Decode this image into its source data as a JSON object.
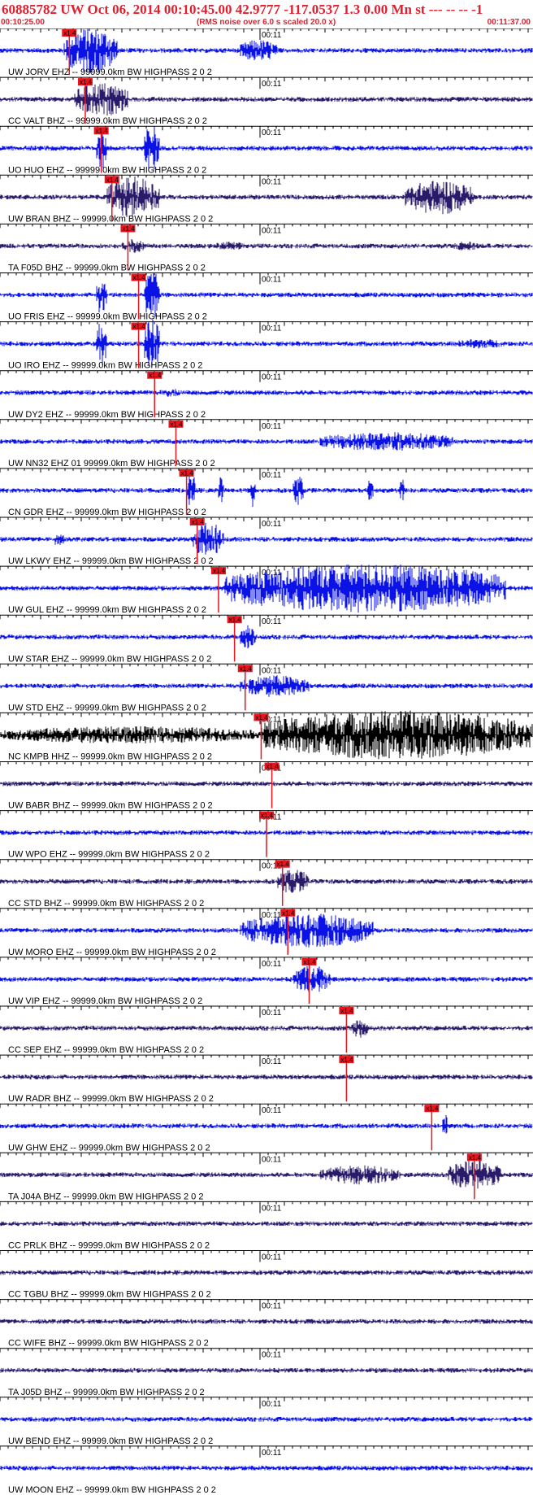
{
  "header": {
    "title": "60885782 UW Oct 06, 2014 00:10:45.00   42.9777 -117.0537  1.3 0.00 Mn st --- -- --   -1",
    "start_time": "00:10:25.00",
    "noise_note": "(RMS noise over 6.0 s scaled 20.0 x)",
    "end_time": "00:11:37.00"
  },
  "time_tick_label": "00:11",
  "pick_label": "x1.4",
  "colors": {
    "header_text": "#e0202e",
    "pick": "#e8141e",
    "trace_blue": "#0a12e6",
    "trace_dark": "#2a1a6a",
    "trace_black": "#000000"
  },
  "traces": [
    {
      "label": "UW JORV EHZ -- 99999.0km BW  HIGHPASS  2  0  2",
      "color": "blue",
      "pick": 0.13,
      "seg": [
        [
          0.12,
          0.22,
          0.95
        ],
        [
          0.45,
          0.52,
          0.45
        ]
      ]
    },
    {
      "label": "CC VALT BHZ -- 99999.0km BW  HIGHPASS  2  0  2",
      "color": "dark",
      "pick": 0.16,
      "seg": [
        [
          0.14,
          0.24,
          0.7
        ]
      ]
    },
    {
      "label": "UO HUO EHZ -- 99999.0km BW  HIGHPASS  2  0  2",
      "color": "blue",
      "pick": 0.19,
      "seg": [
        [
          0.18,
          0.2,
          0.9
        ],
        [
          0.27,
          0.3,
          1.0
        ]
      ]
    },
    {
      "label": "UW BRAN BHZ -- 99999.0km BW  HIGHPASS  2  0  2",
      "color": "dark",
      "pick": 0.21,
      "seg": [
        [
          0.2,
          0.3,
          0.85
        ],
        [
          0.76,
          0.89,
          0.7
        ]
      ]
    },
    {
      "label": "TA F05D BHZ -- 99999.0km BW  HIGHPASS  2  0  2",
      "color": "dark",
      "pick": 0.24,
      "seg": [
        [
          0.23,
          0.27,
          0.3
        ],
        [
          0.4,
          0.46,
          0.18
        ],
        [
          0.85,
          0.9,
          0.2
        ]
      ]
    },
    {
      "label": "UO FRIS EHZ -- 99999.0km BW  HIGHPASS  2  0  2",
      "color": "blue",
      "pick": 0.26,
      "seg": [
        [
          0.18,
          0.2,
          0.8
        ],
        [
          0.27,
          0.3,
          1.0
        ]
      ]
    },
    {
      "label": "UO IRO EHZ -- 99999.0km BW  HIGHPASS  2  0  2",
      "color": "blue",
      "pick": 0.26,
      "seg": [
        [
          0.18,
          0.2,
          0.9
        ],
        [
          0.27,
          0.3,
          1.0
        ],
        [
          0.85,
          0.95,
          0.2
        ]
      ]
    },
    {
      "label": "UW DY2 EHZ -- 99999.0km BW  HIGHPASS  2  0  2",
      "color": "blue",
      "pick": 0.29,
      "seg": [
        [
          0.3,
          0.34,
          0.18
        ]
      ]
    },
    {
      "label": "UW NN32 EHZ 01 99999.0km BW  HIGHPASS  2  0  2",
      "color": "blue",
      "pick": 0.33,
      "seg": [
        [
          0.6,
          0.85,
          0.4
        ]
      ]
    },
    {
      "label": "CN GDR EHZ -- 99999.0km BW  HIGHPASS  2  0  2",
      "color": "blue",
      "pick": 0.35,
      "seg": [
        [
          0.35,
          0.37,
          0.7
        ],
        [
          0.41,
          0.42,
          0.6
        ],
        [
          0.47,
          0.48,
          0.7
        ],
        [
          0.55,
          0.57,
          0.6
        ],
        [
          0.69,
          0.7,
          0.5
        ],
        [
          0.75,
          0.76,
          0.5
        ]
      ]
    },
    {
      "label": "UW LKWY EHZ -- 99999.0km BW  HIGHPASS  2  0  2",
      "color": "blue",
      "pick": 0.37,
      "seg": [
        [
          0.36,
          0.42,
          0.7
        ],
        [
          0.1,
          0.12,
          0.3
        ]
      ]
    },
    {
      "label": "UW GUL EHZ -- 99999.0km BW  HIGHPASS  2  0  2",
      "color": "blue",
      "pick": 0.41,
      "seg": [
        [
          0.42,
          0.95,
          1.0
        ]
      ]
    },
    {
      "label": "UW STAR EHZ -- 99999.0km BW  HIGHPASS  2  0  2",
      "color": "blue",
      "pick": 0.44,
      "seg": [
        [
          0.45,
          0.48,
          0.5
        ]
      ]
    },
    {
      "label": "UW STD EHZ -- 99999.0km BW  HIGHPASS  2  0  2",
      "color": "blue",
      "pick": 0.46,
      "seg": [
        [
          0.45,
          0.58,
          0.45
        ]
      ]
    },
    {
      "label": "NC KMPB HHZ -- 99999.0km BW  HIGHPASS  2  0  2",
      "color": "black",
      "pick": 0.49,
      "seg": [
        [
          0.0,
          0.49,
          0.35
        ],
        [
          0.49,
          1.0,
          1.0
        ]
      ]
    },
    {
      "label": "UW BABR BHZ -- 99999.0km BW  HIGHPASS  2  0  2",
      "color": "dark",
      "pick": 0.51,
      "seg": []
    },
    {
      "label": "UW WPO EHZ -- 99999.0km BW  HIGHPASS  2  0  2",
      "color": "blue",
      "pick": 0.5,
      "seg": []
    },
    {
      "label": "CC STD BHZ -- 99999.0km BW  HIGHPASS  2  0  2",
      "color": "dark",
      "pick": 0.53,
      "seg": [
        [
          0.52,
          0.58,
          0.5
        ]
      ]
    },
    {
      "label": "UW MORO EHZ -- 99999.0km BW  HIGHPASS  2  0  2",
      "color": "blue",
      "pick": 0.54,
      "seg": [
        [
          0.45,
          0.7,
          0.7
        ]
      ]
    },
    {
      "label": "UW VIP EHZ -- 99999.0km BW  HIGHPASS  2  0  2",
      "color": "blue",
      "pick": 0.58,
      "seg": [
        [
          0.55,
          0.62,
          0.6
        ]
      ]
    },
    {
      "label": "CC SEP EHZ -- 99999.0km BW  HIGHPASS  2  0  2",
      "color": "dark",
      "pick": 0.65,
      "seg": [
        [
          0.66,
          0.69,
          0.4
        ]
      ]
    },
    {
      "label": "UW RADR BHZ -- 99999.0km BW  HIGHPASS  2  0  2",
      "color": "dark",
      "pick": 0.65,
      "seg": []
    },
    {
      "label": "UW GHW EHZ -- 99999.0km BW  HIGHPASS  2  0  2",
      "color": "blue",
      "pick": 0.81,
      "seg": [
        [
          0.83,
          0.84,
          0.5
        ]
      ]
    },
    {
      "label": "TA J04A BHZ -- 99999.0km BW  HIGHPASS  2  0  2",
      "color": "dark",
      "pick": 0.89,
      "seg": [
        [
          0.84,
          0.94,
          0.6
        ],
        [
          0.6,
          0.75,
          0.4
        ]
      ]
    },
    {
      "label": "CC PRLK BHZ -- 99999.0km BW  HIGHPASS  2  0  2",
      "color": "dark",
      "pick": null,
      "seg": []
    },
    {
      "label": "CC TGBU BHZ -- 99999.0km BW  HIGHPASS  2  0  2",
      "color": "dark",
      "pick": null,
      "seg": []
    },
    {
      "label": "CC WIFE BHZ -- 99999.0km BW  HIGHPASS  2  0  2",
      "color": "dark",
      "pick": null,
      "seg": []
    },
    {
      "label": "TA J05D BHZ -- 99999.0km BW  HIGHPASS  2  0  2",
      "color": "dark",
      "pick": null,
      "seg": []
    },
    {
      "label": "UW BEND EHZ -- 99999.0km BW  HIGHPASS  2  0  2",
      "color": "blue",
      "pick": null,
      "seg": []
    },
    {
      "label": "UW MOON EHZ -- 99999.0km BW  HIGHPASS  2  0  2",
      "color": "blue",
      "pick": null,
      "seg": []
    }
  ]
}
